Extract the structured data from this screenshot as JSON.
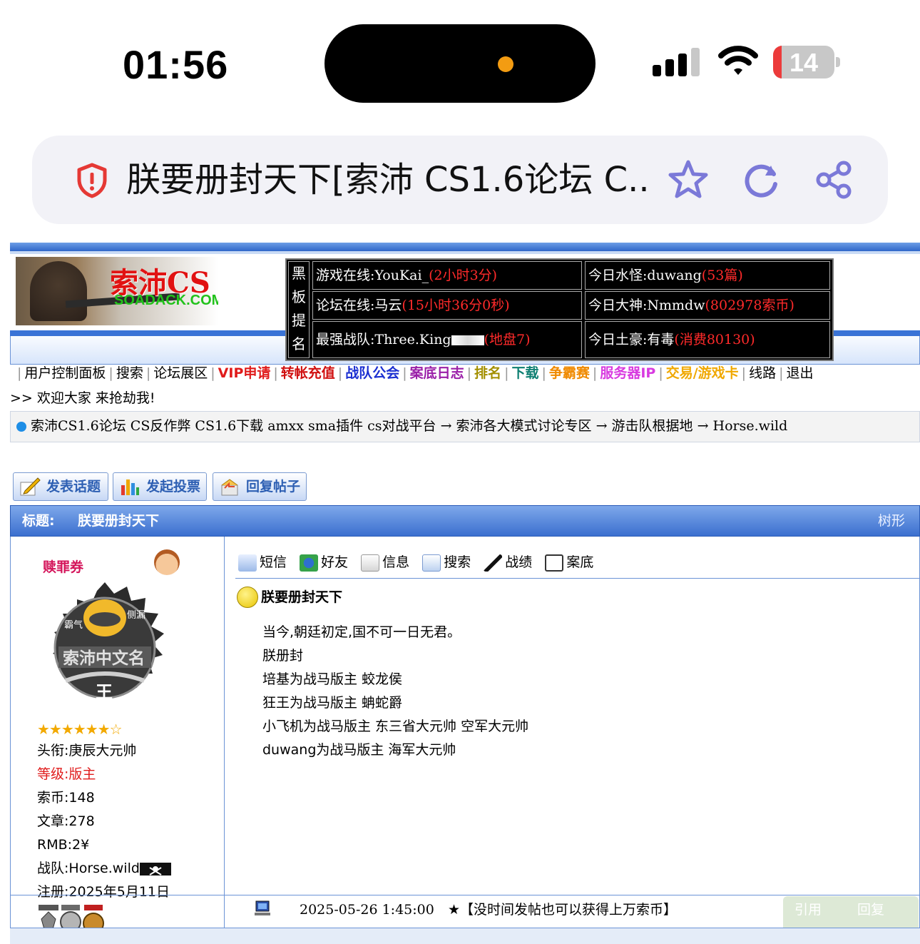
{
  "status": {
    "time": "01:56",
    "battery": "14",
    "battery_level": 0.14
  },
  "browser": {
    "tab_title": "朕要册封天下[索沛 CS1.6论坛 C..."
  },
  "header": {
    "logo_text": "索沛CS",
    "logo_sub": "SOADACK.COM",
    "hall_of_fame": {
      "label": [
        "黑",
        "板",
        "提",
        "名"
      ],
      "cells": [
        {
          "text": "游戏在线:YouKai_",
          "note": "(2小时3分)"
        },
        {
          "text": "今日水怪:duwang",
          "note": "(53篇)"
        },
        {
          "text": "论坛在线:马云",
          "note": "(15小时36分0秒)"
        },
        {
          "text": "今日大神:Nmmdw",
          "note": "(802978索币)"
        },
        {
          "text": "最强战队:Three.King",
          "note": "(地盘7)"
        },
        {
          "text": "今日土豪:有毒",
          "note": "(消费80130)"
        }
      ]
    }
  },
  "nav": {
    "items": [
      {
        "label": "用户控制面板",
        "color": "#000000"
      },
      {
        "label": "搜索",
        "color": "#000000"
      },
      {
        "label": "论坛展区",
        "color": "#000000"
      },
      {
        "label": "VIP申请",
        "color": "#e01b1b"
      },
      {
        "label": "转帐充值",
        "color": "#d01010"
      },
      {
        "label": "战队公会",
        "color": "#1b2fd1"
      },
      {
        "label": "案底日志",
        "color": "#9a1fa8"
      },
      {
        "label": "排名",
        "color": "#a38f00"
      },
      {
        "label": "下载",
        "color": "#0d7f72"
      },
      {
        "label": "争霸赛",
        "color": "#f08a00"
      },
      {
        "label": "服务器IP",
        "color": "#d83ae0"
      },
      {
        "label": "交易/游戏卡",
        "color": "#f0a800"
      },
      {
        "label": "线路",
        "color": "#000000"
      },
      {
        "label": "退出",
        "color": "#000000"
      }
    ],
    "welcome": ">> 欢迎大家 来抢劫我!"
  },
  "breadcrumb": "索沛CS1.6论坛 CS反作弊 CS1.6下载 amxx sma插件 cs对战平台 → 索沛各大模式讨论专区 → 游击队根据地 → Horse.wild",
  "actions": {
    "new_topic": "发表话题",
    "new_poll": "发起投票",
    "reply": "回复帖子"
  },
  "thread": {
    "label": "标题:",
    "title": "朕要册封天下",
    "tree": "树形"
  },
  "user": {
    "name": "赎罪券",
    "avatar_text_top_left": "霸气",
    "avatar_text_top_right": "侧漏",
    "avatar_text_mid": "索沛中文名",
    "avatar_text_bottom": "王",
    "stars": "★★★★★★☆",
    "rank_title": "头衔:庚辰大元帅",
    "level": "等级:版主",
    "coins": "索币:148",
    "posts": "文章:278",
    "rmb": "RMB:2¥",
    "team": "战队:Horse.wild",
    "registered": "注册:2025年5月11日"
  },
  "post": {
    "tools": [
      "短信",
      "好友",
      "信息",
      "搜索",
      "战绩",
      "案底"
    ],
    "title": "朕要册封天下",
    "lines": [
      "当今,朝廷初定,国不可一日无君。",
      "朕册封",
      "培基为战马版主 蛟龙侯",
      "狂王为战马版主 蚺蛇爵",
      "小飞机为战马版主 东三省大元帅 空军大元帅",
      "duwang为战马版主 海军大元帅"
    ],
    "date": "2025-05-26 1:45:00",
    "ad": "★【没时间发帖也可以获得上万索币】",
    "quote": "引用",
    "reply": "回复"
  }
}
